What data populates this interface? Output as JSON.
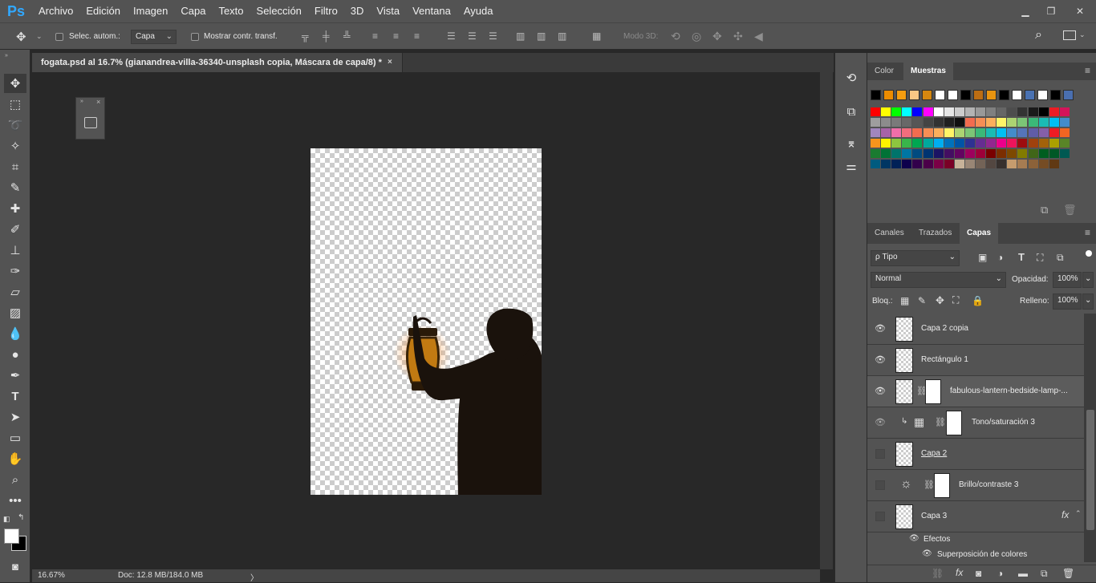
{
  "app": {
    "logo": "Ps"
  },
  "menu": [
    "Archivo",
    "Edición",
    "Imagen",
    "Capa",
    "Texto",
    "Selección",
    "Filtro",
    "3D",
    "Vista",
    "Ventana",
    "Ayuda"
  ],
  "window_controls": {
    "minimize": "▁",
    "restore": "❐",
    "close": "✕"
  },
  "options": {
    "auto_select_label": "Selec. autom.:",
    "auto_select_target": "Capa",
    "transform_label": "Mostrar contr. transf.",
    "mode3d_label": "Modo 3D:"
  },
  "document": {
    "tab_title": "fogata.psd al 16.7% (gianandrea-villa-36340-unsplash copia, Máscara de capa/8) *",
    "close": "×"
  },
  "status": {
    "zoom": "16.67%",
    "doc_size": "Doc: 12.8 MB/184.0 MB",
    "arrow": "〉"
  },
  "panels": {
    "top_tabs": [
      "Color",
      "Muestras"
    ],
    "top_active": "Muestras",
    "swatches_top_row": [
      "#000000",
      "#ec8c00",
      "#f49d10",
      "#f9c784",
      "#d5870f",
      "#ffffff",
      "#ffffff",
      "#000000",
      "#bc6d13",
      "#e89410",
      "#000000",
      "#ffffff",
      "#4a72b2",
      "#ffffff",
      "#000000",
      "#4a6fb0"
    ],
    "layers_tabs": [
      "Canales",
      "Trazados",
      "Capas"
    ],
    "layers_active": "Capas",
    "filter_label": "ρ Tipo",
    "blend_mode": "Normal",
    "opacity_label": "Opacidad:",
    "opacity_value": "100%",
    "lock_label": "Bloq.:",
    "fill_label": "Relleno:",
    "fill_value": "100%"
  },
  "layers": [
    {
      "name": "Capa 2 copia"
    },
    {
      "name": "Rectángulo 1"
    },
    {
      "name": "fabulous-lantern-bedside-lamp-..."
    },
    {
      "name": "Tono/saturación 3"
    },
    {
      "name": "Capa 2"
    },
    {
      "name": "Brillo/contraste 3"
    },
    {
      "name": "Capa 3",
      "fx": "fx"
    }
  ],
  "effects": {
    "title": "Efectos",
    "item": "Superposición de colores"
  }
}
